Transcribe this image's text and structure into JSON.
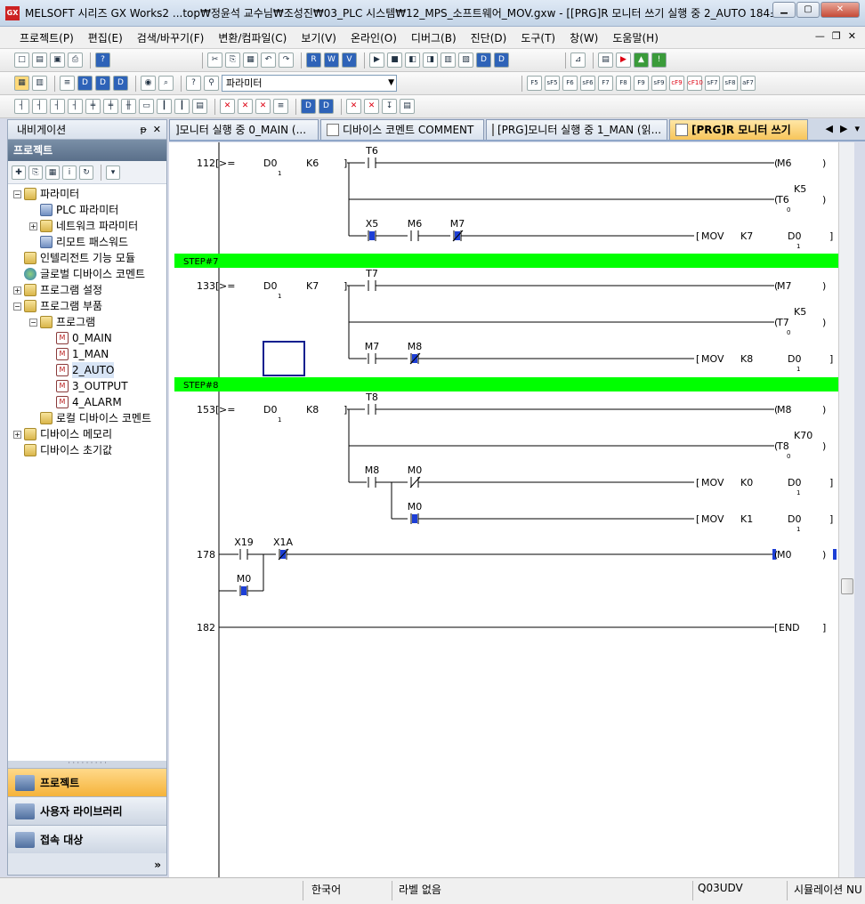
{
  "window": {
    "title": "MELSOFT 시리즈 GX Works2 ...top₩정윤석 교수님₩조성진₩03_PLC 시스템₩12_MPS_소프트웨어_MOV.gxw - [[PRG]R 모니터 쓰기 실행 중 2_AUTO 184스...",
    "app_icon": "GX"
  },
  "menu": [
    "프로젝트(P)",
    "편집(E)",
    "검색/바꾸기(F)",
    "변환/컴파일(C)",
    "보기(V)",
    "온라인(O)",
    "디버그(B)",
    "진단(D)",
    "도구(T)",
    "창(W)",
    "도움말(H)"
  ],
  "toolbar": {
    "combo_value": "파라미터",
    "fkeys": [
      "F5",
      "sF5",
      "F6",
      "sF6",
      "F7",
      "F8",
      "F9",
      "sF9",
      "cF9",
      "cF10",
      "sF7",
      "sF8",
      "aF7"
    ]
  },
  "nav": {
    "title": "내비게이션",
    "section": "프로젝트",
    "tree": [
      {
        "label": "파라미터",
        "level": 0,
        "exp": "-",
        "icon": "folder"
      },
      {
        "label": "PLC 파라미터",
        "level": 1,
        "exp": "",
        "icon": "param"
      },
      {
        "label": "네트워크 파라미터",
        "level": 1,
        "exp": "+",
        "icon": "folder"
      },
      {
        "label": "리모트 패스워드",
        "level": 1,
        "exp": "",
        "icon": "param"
      },
      {
        "label": "인텔리전트 기능 모듈",
        "level": 0,
        "exp": "",
        "icon": "folder"
      },
      {
        "label": "글로벌 디바이스 코멘트",
        "level": 0,
        "exp": "",
        "icon": "globe"
      },
      {
        "label": "프로그램 설정",
        "level": 0,
        "exp": "+",
        "icon": "folder"
      },
      {
        "label": "프로그램 부품",
        "level": 0,
        "exp": "-",
        "icon": "folder"
      },
      {
        "label": "프로그램",
        "level": 1,
        "exp": "-",
        "icon": "folder"
      },
      {
        "label": "0_MAIN",
        "level": 2,
        "exp": "",
        "icon": "prog"
      },
      {
        "label": "1_MAN",
        "level": 2,
        "exp": "",
        "icon": "prog"
      },
      {
        "label": "2_AUTO",
        "level": 2,
        "exp": "",
        "icon": "prog",
        "selected": true
      },
      {
        "label": "3_OUTPUT",
        "level": 2,
        "exp": "",
        "icon": "prog"
      },
      {
        "label": "4_ALARM",
        "level": 2,
        "exp": "",
        "icon": "prog"
      },
      {
        "label": "로컬 디바이스 코멘트",
        "level": 1,
        "exp": "",
        "icon": "folder"
      },
      {
        "label": "디바이스 메모리",
        "level": 0,
        "exp": "+",
        "icon": "folder"
      },
      {
        "label": "디바이스 초기값",
        "level": 0,
        "exp": "",
        "icon": "folder"
      }
    ],
    "bottom_tabs": [
      "프로젝트",
      "사용자 라이브러리",
      "접속 대상"
    ]
  },
  "tabs": [
    "]모니터 실행 중 0_MAIN (...",
    "디바이스 코멘트 COMMENT",
    "[PRG]모니터 실행 중 1_MAN (읽...",
    "[PRG]R 모니터 쓰기"
  ],
  "ladder": {
    "steps": [
      "112",
      "133",
      "153",
      "178",
      "182"
    ],
    "step_labels": [
      "STEP#7",
      "STEP#8"
    ],
    "labels": {
      "cmp": ">=",
      "d0": "D0",
      "sub1": "1",
      "k6": "K6",
      "k7": "K7",
      "k8": "K8",
      "t6": "T6",
      "t7": "T7",
      "t8": "T8",
      "k5": "K5",
      "k70": "K70",
      "sub0": "0",
      "m6": "M6",
      "m7": "M7",
      "m8": "M8",
      "x5": "X5",
      "m0": "M0",
      "mov": "MOV",
      "k0": "K0",
      "k1": "K1",
      "x19": "X19",
      "x1a": "X1A",
      "end": "END"
    },
    "colors": {
      "step_band": "#00ff00",
      "active": "#1d3fd6",
      "selection": "#0a1f8f"
    }
  },
  "status": {
    "language": "한국어",
    "label": "라벨 없음",
    "cpu": "Q03UDV",
    "mode": "시뮬레이션 NU"
  }
}
